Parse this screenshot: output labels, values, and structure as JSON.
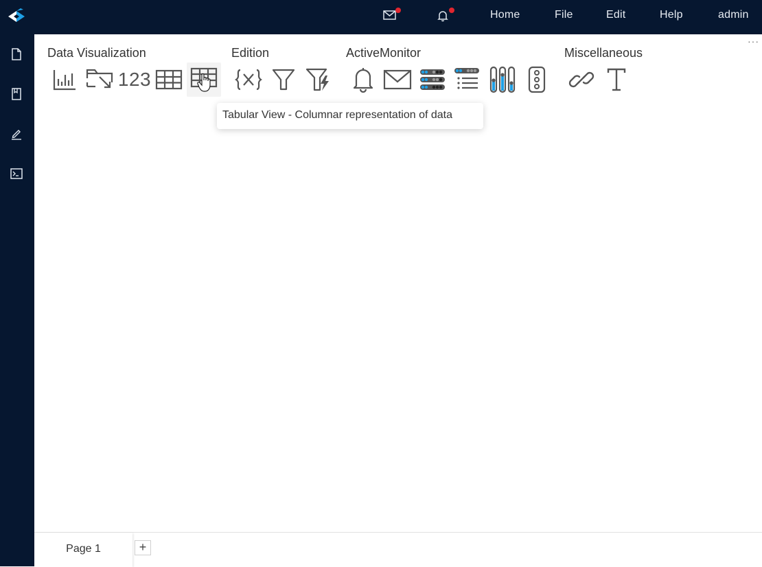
{
  "header": {
    "nav": [
      "Home",
      "File",
      "Edit",
      "Help",
      "admin"
    ]
  },
  "groups": {
    "data_visualization": "Data Visualization",
    "edition": "Edition",
    "active_monitor": "ActiveMonitor",
    "miscellaneous": "Miscellaneous"
  },
  "toolbar": {
    "kpi_label": "123",
    "more": "···"
  },
  "tooltip": "Tabular View - Columnar representation of data",
  "pages": {
    "tab": "Page 1",
    "add": "+"
  },
  "colors": {
    "nav_bg": "#061730",
    "accent_blue": "#1ea0e6",
    "notification_dot": "#e0262f",
    "icon_gray": "#555555"
  }
}
